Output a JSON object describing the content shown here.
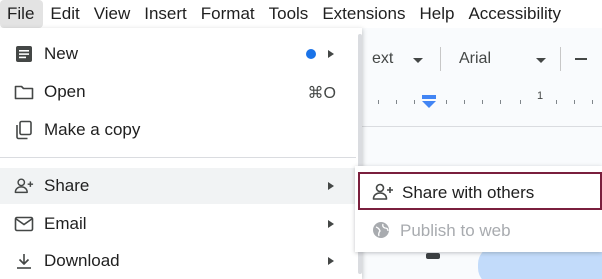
{
  "menubar": {
    "items": [
      "File",
      "Edit",
      "View",
      "Insert",
      "Format",
      "Tools",
      "Extensions",
      "Help",
      "Accessibility"
    ]
  },
  "toolbar": {
    "style_text": "ext",
    "font": "Arial"
  },
  "ruler": {
    "number": "1"
  },
  "file_menu": {
    "new_label": "New",
    "open_label": "Open",
    "open_shortcut": "⌘O",
    "copy_label": "Make a copy",
    "share_label": "Share",
    "email_label": "Email",
    "download_label": "Download"
  },
  "share_submenu": {
    "share_others_label": "Share with others",
    "publish_label": "Publish to web"
  },
  "colors": {
    "accent_dot": "#1a73e8",
    "highlight_border": "#7a1f3d",
    "hover_row": "#f1f3f4"
  },
  "icons": [
    "document-icon",
    "folder-icon",
    "copy-icon",
    "add-person-icon",
    "email-icon",
    "download-icon",
    "globe-icon"
  ]
}
